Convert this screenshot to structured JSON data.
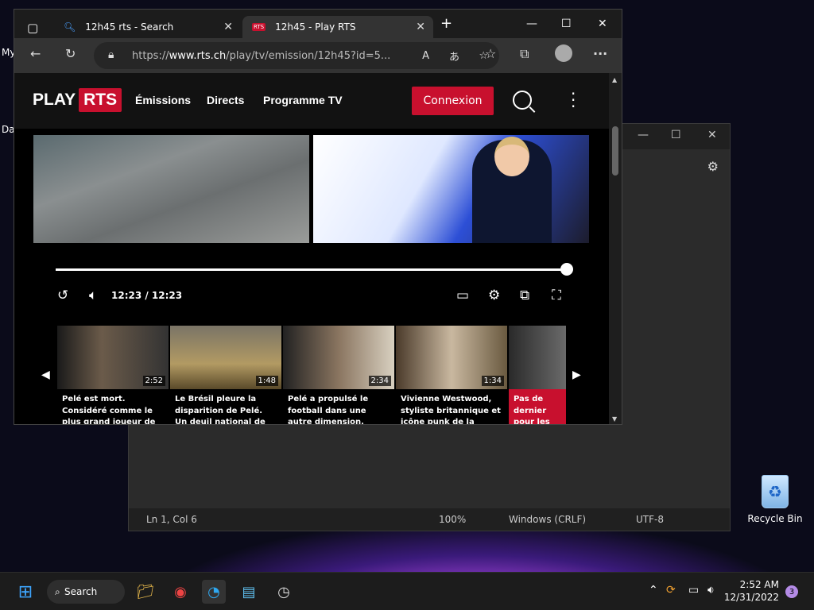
{
  "desktop": {
    "label_my": "My",
    "label_da": "Da",
    "recycle_bin": "Recycle Bin"
  },
  "notepad": {
    "status": {
      "position": "Ln 1, Col 6",
      "zoom": "100%",
      "line_ending": "Windows (CRLF)",
      "encoding": "UTF-8"
    }
  },
  "browser": {
    "tabs": [
      {
        "label": "12h45 rts - Search",
        "icon": "search-icon"
      },
      {
        "label": "12h45 - Play RTS",
        "icon": "rts-favicon"
      }
    ],
    "url_prefix": "https://",
    "url_domain": "www.rts.ch",
    "url_path": "/play/tv/emission/12h45?id=5..."
  },
  "site": {
    "logo_play": "PLAY",
    "logo_rts": "RTS",
    "nav": [
      "Émissions",
      "Directs",
      "Programme TV"
    ],
    "login": "Connexion",
    "player": {
      "time": "12:23 / 12:23",
      "progress": 1.0
    },
    "cards": [
      {
        "duration": "2:52",
        "title": "Pelé est mort. Considéré comme le plus grand joueur de football de tous..."
      },
      {
        "duration": "1:48",
        "title": "Le Brésil pleure la disparition de Pelé. Un deuil national de trois jou..."
      },
      {
        "duration": "2:34",
        "title": "Pelé a propulsé le football dans une autre dimension. L'hommage de Michel Pon..."
      },
      {
        "duration": "1:34",
        "title": "Vivienne Westwood, styliste britannique et icône punk de la mode,..."
      },
      {
        "duration": "",
        "title": "Pas de dernier pour les habit de quartier à V"
      }
    ]
  },
  "taskbar": {
    "search": "Search",
    "time": "2:52 AM",
    "date": "12/31/2022",
    "notifications": "3"
  }
}
